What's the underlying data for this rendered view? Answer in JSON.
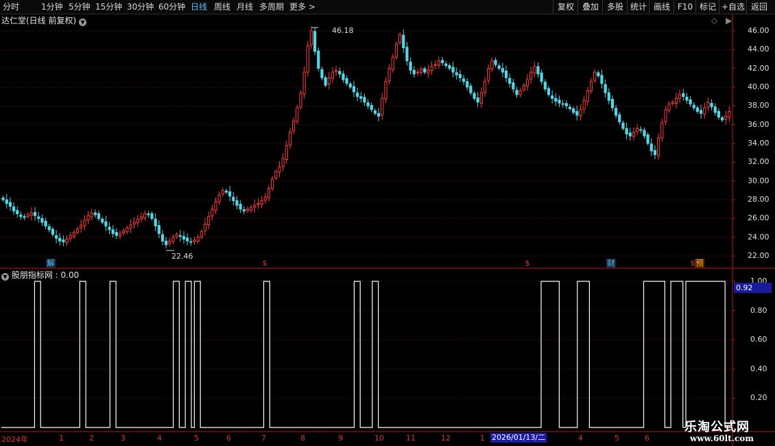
{
  "toolbar": {
    "periods": [
      "分时",
      "1分钟",
      "5分钟",
      "15分钟",
      "30分钟",
      "60分钟",
      "日线",
      "周线",
      "月线",
      "多周期",
      "更多 >"
    ],
    "active": "日线",
    "buttons": [
      "复权",
      "叠加",
      "多股",
      "统计",
      "画线",
      "F10",
      "标记",
      "+自选",
      "返回"
    ]
  },
  "main_pane": {
    "title": "达仁堂(日线 前复权)",
    "high_note": "46.18",
    "low_note": "22.46",
    "y_ticks": [
      "46.00",
      "44.00",
      "42.00",
      "40.00",
      "38.00",
      "36.00",
      "34.00",
      "32.00",
      "30.00",
      "28.00",
      "26.00",
      "24.00",
      "22.00"
    ],
    "events": [
      {
        "label": "解",
        "color": "#5fb8e8"
      },
      {
        "label": "$",
        "color": "#e23b3b"
      },
      {
        "label": "$",
        "color": "#e23b3b"
      },
      {
        "label": "财",
        "color": "#5fb8e8"
      },
      {
        "label": "$",
        "color": "#e23b3b"
      },
      {
        "label": "预",
        "color": "#ffb000"
      }
    ]
  },
  "indicator_pane": {
    "title": "股朋指标网 : 0.00",
    "current_value": "0.92",
    "y_ticks": [
      "1.00",
      "0.80",
      "0.60",
      "0.40",
      "0.20"
    ]
  },
  "x_axis": {
    "labels": [
      "2024年",
      "1",
      "2",
      "3",
      "4",
      "5",
      "6",
      "7",
      "8",
      "9",
      "10",
      "11",
      "12",
      "1",
      "4",
      "5",
      "6"
    ],
    "cursor_date": "2026/01/13/二"
  },
  "watermark": {
    "title": "乐淘公式网",
    "url": "www.60lt.com"
  },
  "colors": {
    "up": "#ff3b3b",
    "down": "#55d6e6",
    "grid": "#7a1010",
    "axis": "#c01818",
    "active_tab": "#58c0ff"
  },
  "chart_data": [
    {
      "type": "candlestick",
      "title": "达仁堂(日线 前复权)",
      "ylim": [
        21.5,
        46.8
      ],
      "series": [
        {
          "values": [
            28.0,
            27.6,
            27.3,
            26.8,
            26.5,
            26.2,
            26.1,
            26.4,
            26.6,
            26.3,
            26.0,
            25.6,
            25.2,
            24.8,
            24.3,
            23.9,
            23.6,
            23.5,
            23.8,
            24.2,
            24.5,
            24.9,
            25.3,
            25.8,
            26.3,
            26.6,
            26.4,
            26.0,
            25.6,
            25.2,
            24.8,
            24.4,
            24.2,
            24.4,
            24.7,
            25.0,
            25.3,
            25.6,
            25.9,
            26.2,
            26.5,
            26.4,
            26.0,
            25.2,
            24.4,
            23.6,
            23.2,
            23.6,
            24.0,
            24.3,
            24.1,
            23.8,
            23.6,
            23.5,
            23.7,
            24.0,
            24.6,
            25.4,
            26.2,
            27.0,
            27.8,
            28.5,
            29.0,
            28.8,
            28.4,
            27.9,
            27.4,
            27.0,
            26.8,
            27.0,
            27.2,
            27.4,
            27.6,
            27.9,
            28.3,
            29.2,
            30.2,
            31.0,
            31.5,
            32.4,
            33.8,
            35.2,
            36.4,
            37.8,
            39.4,
            41.6,
            44.4,
            46.0,
            43.8,
            42.0,
            41.0,
            40.2,
            41.0,
            41.6,
            41.8,
            41.4,
            40.8,
            40.4,
            40.0,
            39.5,
            39.0,
            38.8,
            38.4,
            38.0,
            37.6,
            37.2,
            36.9,
            38.8,
            40.6,
            42.0,
            43.2,
            44.6,
            45.6,
            44.2,
            42.8,
            41.8,
            41.4,
            41.6,
            41.9,
            41.6,
            41.8,
            42.2,
            42.4,
            42.8,
            42.6,
            42.3,
            42.0,
            41.6,
            41.3,
            41.0,
            40.6,
            40.0,
            39.4,
            38.8,
            38.4,
            39.4,
            40.6,
            42.0,
            42.8,
            42.4,
            42.0,
            41.6,
            41.0,
            40.4,
            39.8,
            39.2,
            39.6,
            40.2,
            40.8,
            41.6,
            42.2,
            41.4,
            40.6,
            39.8,
            39.2,
            38.8,
            38.5,
            38.3,
            38.2,
            38.0,
            37.7,
            37.3,
            37.0,
            37.6,
            38.6,
            39.6,
            40.6,
            41.6,
            41.2,
            40.4,
            39.4,
            38.6,
            37.8,
            37.0,
            36.3,
            35.6,
            35.0,
            34.8,
            35.2,
            35.6,
            35.4,
            34.8,
            34.0,
            33.2,
            32.8,
            34.6,
            36.2,
            37.6,
            38.2,
            38.4,
            38.8,
            39.2,
            39.0,
            38.6,
            38.2,
            37.8,
            37.4,
            37.2,
            37.8,
            38.4,
            37.9,
            37.3,
            36.8,
            36.5,
            36.9,
            37.4
          ]
        }
      ]
    },
    {
      "type": "line",
      "title": "股朋指标网",
      "ylim": [
        0,
        1
      ],
      "series": [
        {
          "values": [
            0,
            0,
            0,
            0,
            0,
            0,
            0,
            0,
            0,
            0,
            0,
            1,
            1,
            0,
            0,
            0,
            0,
            0,
            0,
            0,
            0,
            0,
            0,
            0,
            0,
            0,
            1,
            1,
            0,
            0,
            0,
            0,
            0,
            0,
            0,
            0,
            1,
            1,
            0,
            0,
            0,
            0,
            0,
            0,
            0,
            0,
            0,
            0,
            0,
            0,
            0,
            0,
            0,
            0,
            0,
            0,
            0,
            1,
            1,
            0,
            0,
            1,
            1,
            0,
            1,
            1,
            0,
            0,
            0,
            0,
            0,
            0,
            0,
            0,
            0,
            0,
            0,
            0,
            0,
            0,
            0,
            0,
            0,
            0,
            0,
            0,
            0,
            1,
            1,
            0,
            0,
            0,
            0,
            0,
            0,
            0,
            0,
            0,
            0,
            0,
            0,
            0,
            0,
            0,
            0,
            0,
            0,
            0,
            0,
            0,
            0,
            0,
            0,
            0,
            0,
            0,
            0,
            1,
            1,
            0,
            0,
            0,
            0,
            1,
            1,
            0,
            0,
            0,
            0,
            0,
            0,
            0,
            0,
            0,
            0,
            0,
            0,
            0,
            0,
            0,
            0,
            0,
            0,
            0,
            0,
            0,
            0,
            0,
            0,
            0,
            0,
            0,
            0,
            0,
            0,
            0,
            0,
            0,
            0,
            0,
            0,
            0,
            0,
            0,
            0,
            0,
            0,
            0,
            0,
            0,
            0,
            0,
            0,
            0,
            0,
            0,
            0,
            0,
            0,
            1,
            1,
            1,
            1,
            1,
            1,
            0,
            0,
            0,
            0,
            0,
            0,
            1,
            1,
            1,
            1,
            0,
            0,
            0,
            0,
            0,
            0,
            0,
            0,
            0,
            0,
            0,
            0,
            0,
            0,
            0,
            0,
            0,
            0,
            1,
            1,
            1,
            1,
            1,
            1,
            1,
            0,
            0,
            1,
            1,
            1,
            1,
            0,
            1,
            1,
            1,
            1,
            1,
            1,
            1,
            1,
            1,
            1,
            1,
            1,
            1,
            0,
            0
          ]
        }
      ]
    }
  ]
}
